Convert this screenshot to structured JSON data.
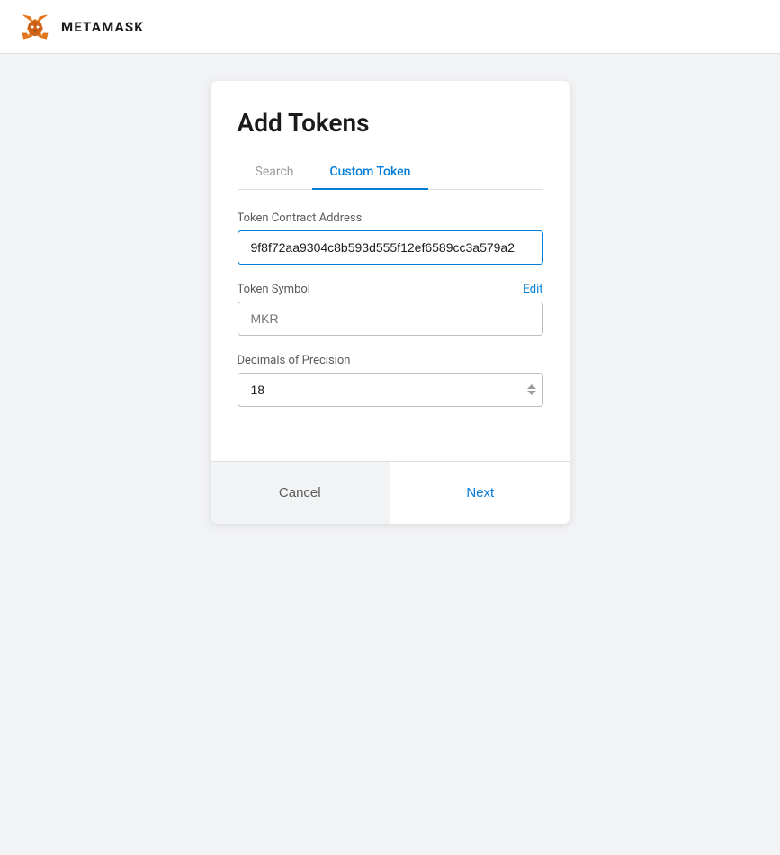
{
  "header": {
    "title": "METAMASK",
    "logo_alt": "MetaMask Fox Logo"
  },
  "card": {
    "title": "Add Tokens",
    "tabs": [
      {
        "id": "search",
        "label": "Search",
        "active": false
      },
      {
        "id": "custom-token",
        "label": "Custom Token",
        "active": true
      }
    ],
    "form": {
      "contract_address": {
        "label": "Token Contract Address",
        "value": "9f8f72aa9304c8b593d555f12ef6589cc3a579a2",
        "placeholder": ""
      },
      "token_symbol": {
        "label": "Token Symbol",
        "edit_label": "Edit",
        "placeholder": "MKR",
        "value": ""
      },
      "decimals": {
        "label": "Decimals of Precision",
        "value": "18",
        "placeholder": ""
      }
    },
    "footer": {
      "cancel_label": "Cancel",
      "next_label": "Next"
    }
  }
}
